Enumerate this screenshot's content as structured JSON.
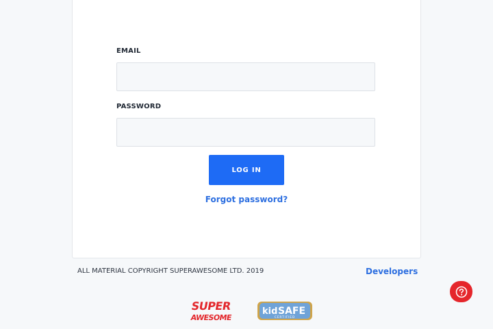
{
  "form": {
    "email_label": "EMAIL",
    "email_value": "",
    "password_label": "PASSWORD",
    "password_value": "",
    "login_label": "LOG IN",
    "forgot_label": "Forgot password?"
  },
  "footer": {
    "copyright": "ALL MATERIAL COPYRIGHT SUPERAWESOME LTD. 2019",
    "developers_label": "Developers"
  },
  "logos": {
    "superawesome_line1": "SUPER",
    "superawesome_line2": "AWESOME",
    "kidsafe_main_kid": "kid",
    "kidsafe_main_safe": "SAFE",
    "kidsafe_sub": "CERTIFIED"
  },
  "colors": {
    "accent": "#1e6bf5",
    "link": "#2d6fe0",
    "help": "#e5262b",
    "superawesome": "#e3262b"
  },
  "icons": {
    "help": "question-circle-icon"
  }
}
